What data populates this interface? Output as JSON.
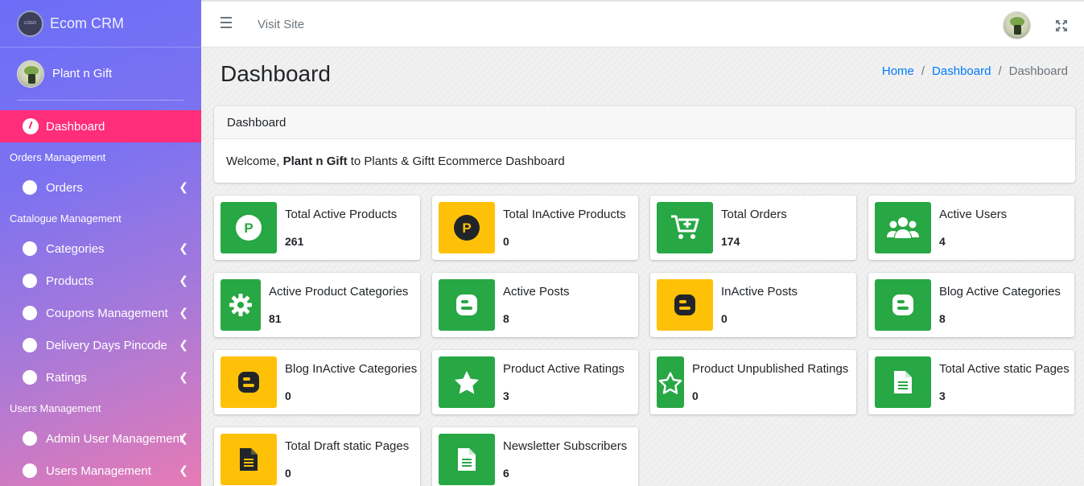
{
  "brand": {
    "logo_text": "LOGO",
    "name": "Ecom CRM"
  },
  "user": {
    "name": "Plant n Gift"
  },
  "sidebar": {
    "dashboard": "Dashboard",
    "orders_header": "Orders Management",
    "orders": "Orders",
    "catalogue_header": "Catalogue Management",
    "categories": "Categories",
    "products": "Products",
    "coupons": "Coupons Management",
    "delivery": "Delivery Days Pincode",
    "ratings": "Ratings",
    "users_header": "Users Management",
    "admin_users": "Admin User Management",
    "users": "Users Management"
  },
  "topbar": {
    "visit_site": "Visit Site"
  },
  "page": {
    "title": "Dashboard"
  },
  "breadcrumb": {
    "home": "Home",
    "dashboard_link": "Dashboard",
    "current": "Dashboard"
  },
  "welcome": {
    "header": "Dashboard",
    "prefix": "Welcome, ",
    "name": "Plant n Gift",
    "suffix": " to Plants & Giftt Ecommerce Dashboard"
  },
  "colors": {
    "green": "#28a745",
    "yellow": "#ffc107",
    "active": "#ff2d7a",
    "link": "#007bff"
  },
  "stats": [
    {
      "label": "Total Active Products",
      "value": "261",
      "icon": "p-circle-icon"
    },
    {
      "label": "Total InActive Products",
      "value": "0",
      "icon": "p-circle-icon"
    },
    {
      "label": "Total Orders",
      "value": "174",
      "icon": "cart-plus-icon"
    },
    {
      "label": "Active Users",
      "value": "4",
      "icon": "users-icon"
    },
    {
      "label": "Active Product Categories",
      "value": "81",
      "icon": "gear-icon"
    },
    {
      "label": "Active Posts",
      "value": "8",
      "icon": "blogger-icon"
    },
    {
      "label": "InActive Posts",
      "value": "0",
      "icon": "blogger-icon"
    },
    {
      "label": "Blog Active Categories",
      "value": "8",
      "icon": "blogger-icon"
    },
    {
      "label": "Blog InActive Categories",
      "value": "0",
      "icon": "blogger-icon"
    },
    {
      "label": "Product Active Ratings",
      "value": "3",
      "icon": "star-icon"
    },
    {
      "label": "Product Unpublished Ratings",
      "value": "0",
      "icon": "star-outline-icon"
    },
    {
      "label": "Total Active static Pages",
      "value": "3",
      "icon": "file-icon"
    },
    {
      "label": "Total Draft static Pages",
      "value": "0",
      "icon": "file-icon"
    },
    {
      "label": "Newsletter Subscribers",
      "value": "6",
      "icon": "file-icon"
    }
  ]
}
